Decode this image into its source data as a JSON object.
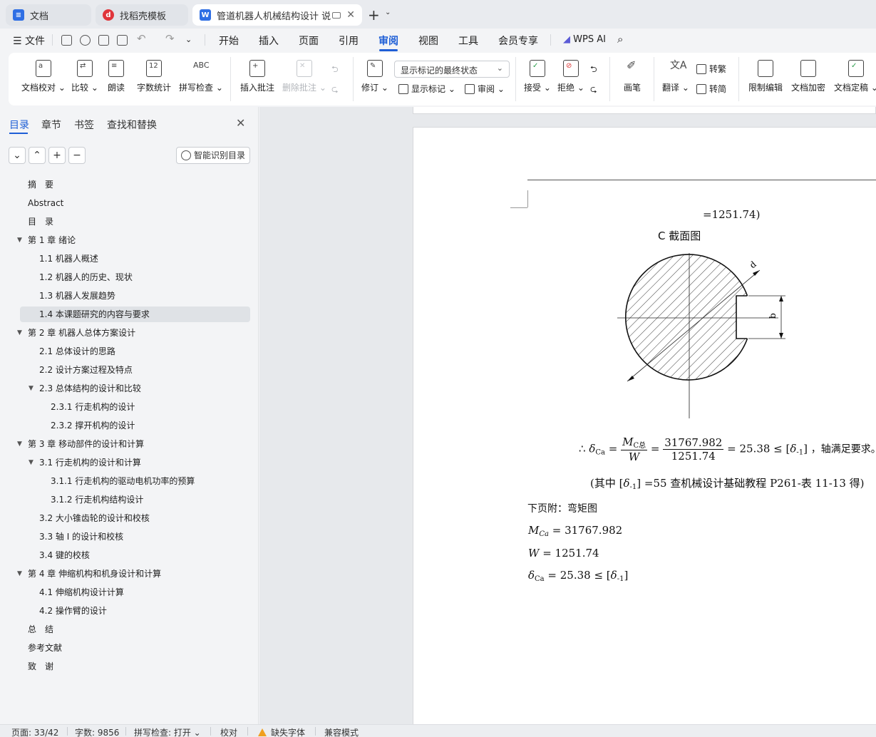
{
  "tabs": [
    {
      "label": "文档",
      "icon": "doc-icon",
      "color": "#2f6fe4"
    },
    {
      "label": "找稻壳模板",
      "icon": "docer-icon",
      "color": "#e0353b"
    },
    {
      "label": "管道机器人机械结构设计 说明",
      "icon": "wps-writer-icon",
      "color": "#2f6fe4"
    }
  ],
  "menubar": {
    "file": "文件",
    "items": [
      "开始",
      "插入",
      "页面",
      "引用",
      "审阅",
      "视图",
      "工具",
      "会员专享"
    ],
    "active": "审阅",
    "wps_ai": "WPS AI"
  },
  "ribbon": {
    "doc_check": "文档校对",
    "compare": "比较",
    "read_aloud": "朗读",
    "word_count": "字数统计",
    "spell_check": "拼写检查",
    "spell_icon_text": "ABC",
    "word_count_icon_text": "12",
    "insert_comment": "插入批注",
    "delete_comment": "删除批注",
    "revise": "修订",
    "markup_state": "显示标记的最终状态",
    "show_markup": "显示标记",
    "review": "审阅",
    "accept": "接受",
    "reject": "拒绝",
    "pen": "画笔",
    "translate": "翻译",
    "to_traditional": "转繁",
    "to_simplified": "转简",
    "restrict_edit": "限制编辑",
    "doc_encrypt": "文档加密",
    "doc_finalize": "文档定稿"
  },
  "sidebar": {
    "tabs": [
      "目录",
      "章节",
      "书签",
      "查找和替换"
    ],
    "active_tab": "目录",
    "smart_toc": "智能识别目录",
    "toc": [
      {
        "label": "摘　要",
        "level": 0,
        "caret": false
      },
      {
        "label": "Abstract",
        "level": 0,
        "caret": false
      },
      {
        "label": "目　录",
        "level": 0,
        "caret": false
      },
      {
        "label": "第 1 章  绪论",
        "level": 0,
        "caret": true
      },
      {
        "label": "1.1  机器人概述",
        "level": 1,
        "caret": false
      },
      {
        "label": "1.2  机器人的历史、现状",
        "level": 1,
        "caret": false
      },
      {
        "label": "1.3 机器人发展趋势",
        "level": 1,
        "caret": false
      },
      {
        "label": "1.4  本课题研究的内容与要求",
        "level": 1,
        "caret": false,
        "selected": true
      },
      {
        "label": "第 2 章  机器人总体方案设计",
        "level": 0,
        "caret": true
      },
      {
        "label": "2.1 总体设计的思路",
        "level": 1,
        "caret": false
      },
      {
        "label": "2.2  设计方案过程及特点",
        "level": 1,
        "caret": false
      },
      {
        "label": "2.3  总体结构的设计和比较",
        "level": 1,
        "caret": true
      },
      {
        "label": "2.3.1  行走机构的设计",
        "level": 2,
        "caret": false
      },
      {
        "label": "2.3.2  撑开机构的设计",
        "level": 2,
        "caret": false
      },
      {
        "label": "第 3 章  移动部件的设计和计算",
        "level": 0,
        "caret": true
      },
      {
        "label": "3.1  行走机构的设计和计算",
        "level": 1,
        "caret": true
      },
      {
        "label": "3.1.1  行走机构的驱动电机功率的预算",
        "level": 2,
        "caret": false
      },
      {
        "label": "3.1.2  行走机构结构设计",
        "level": 2,
        "caret": false
      },
      {
        "label": "3.2 大小锥齿轮的设计和校核",
        "level": 1,
        "caret": false
      },
      {
        "label": "3.3  轴 I 的设计和校核",
        "level": 1,
        "caret": false
      },
      {
        "label": "3.4  键的校核",
        "level": 1,
        "caret": false
      },
      {
        "label": "第 4 章  伸缩机构和机身设计和计算",
        "level": 0,
        "caret": true
      },
      {
        "label": "4.1  伸缩机构设计计算",
        "level": 1,
        "caret": false
      },
      {
        "label": "4.2  操作臂的设计",
        "level": 1,
        "caret": false
      },
      {
        "label": "总　结",
        "level": 0,
        "caret": false
      },
      {
        "label": "参考文献",
        "level": 0,
        "caret": false
      },
      {
        "label": "致　谢",
        "level": 0,
        "caret": false
      }
    ]
  },
  "document": {
    "line_top": "=1251.74)",
    "caption": "C 截面图",
    "dim_d": "d",
    "dim_b": "b",
    "formula1": {
      "prefix": "∴",
      "lhs": "δ",
      "lhs_sub": "Ca",
      "frac1_num": "M",
      "frac1_num_sub": "C总",
      "frac1_den": "W",
      "frac2_num": "31767.982",
      "frac2_den": "1251.74",
      "result": "= 25.38 ≤ [",
      "rhs": "δ",
      "rhs_sub": "-1",
      "close": "]",
      "conclusion": "，轴满足要求。"
    },
    "note_prefix": "(其中 [",
    "note_delta": "δ",
    "note_delta_sub": "-1",
    "note_suffix": "] =55 查机械设计基础教程 P261-表 11-13 得)",
    "next_page": "下页附：弯矩图",
    "m_label": "M",
    "m_sub": "Ca",
    "m_value": " = 31767.982",
    "w_label": "W",
    "w_value": " = 1251.74",
    "s_label": "δ",
    "s_sub": "Ca",
    "s_value": " = 25.38 ≤ [",
    "s_rhs": "δ",
    "s_rhs_sub": "-1",
    "s_close": "]"
  },
  "statusbar": {
    "page": "页面: 33/42",
    "words": "字数: 9856",
    "spell": "拼写检查: 打开",
    "proof": "校对",
    "missing_font": "缺失字体",
    "compat": "兼容模式"
  }
}
